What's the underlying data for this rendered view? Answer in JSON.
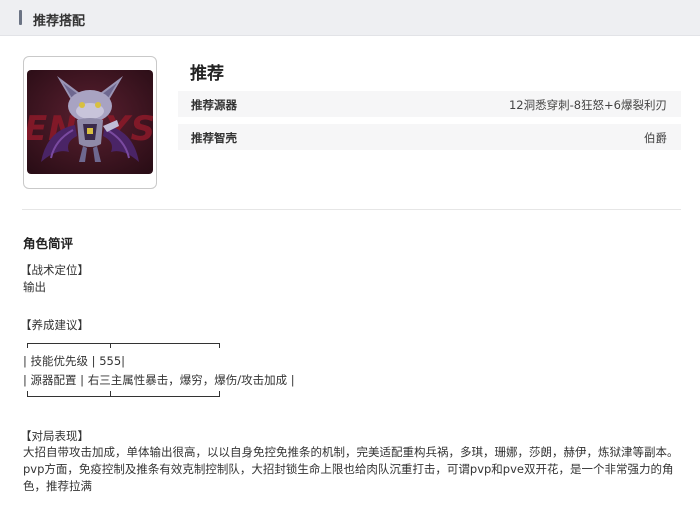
{
  "header": {
    "title": "推荐搭配"
  },
  "portrait": {
    "icon": "character-portrait",
    "background_text": "ENVYS",
    "colors": {
      "background": "#3a1420",
      "text": "#8c1a2a",
      "body": "#8f8aa8",
      "wing": "#5a2f7a"
    }
  },
  "recommend": {
    "title": "推荐",
    "rows": [
      {
        "key": "推荐源器",
        "value": "12洞悉穿刺-8狂怒+6爆裂利刃"
      },
      {
        "key": "推荐智壳",
        "value": "伯爵"
      }
    ]
  },
  "review": {
    "title": "角色简评",
    "position_label": "【战术定位】",
    "position_value": "输出",
    "growth_label": "【养成建议】",
    "table_row1": "| 技能优先级 | 555|",
    "table_row2": "| 源器配置 | 右三主属性暴击，爆穷，爆伤/攻击加成 |",
    "performance_label": "【对局表现】",
    "performance_text": "大招自带攻击加成，单体输出很高，以以自身免控免推条的机制，完美适配重构兵祸，多琪，珊娜，莎朗，赫伊，炼狱津等副本。pvp方面，免疫控制及推条有效克制控制队，大招封锁生命上限也给肉队沉重打击，可谓pvp和pve双开花，是一个非常强力的角色，推荐拉满"
  }
}
